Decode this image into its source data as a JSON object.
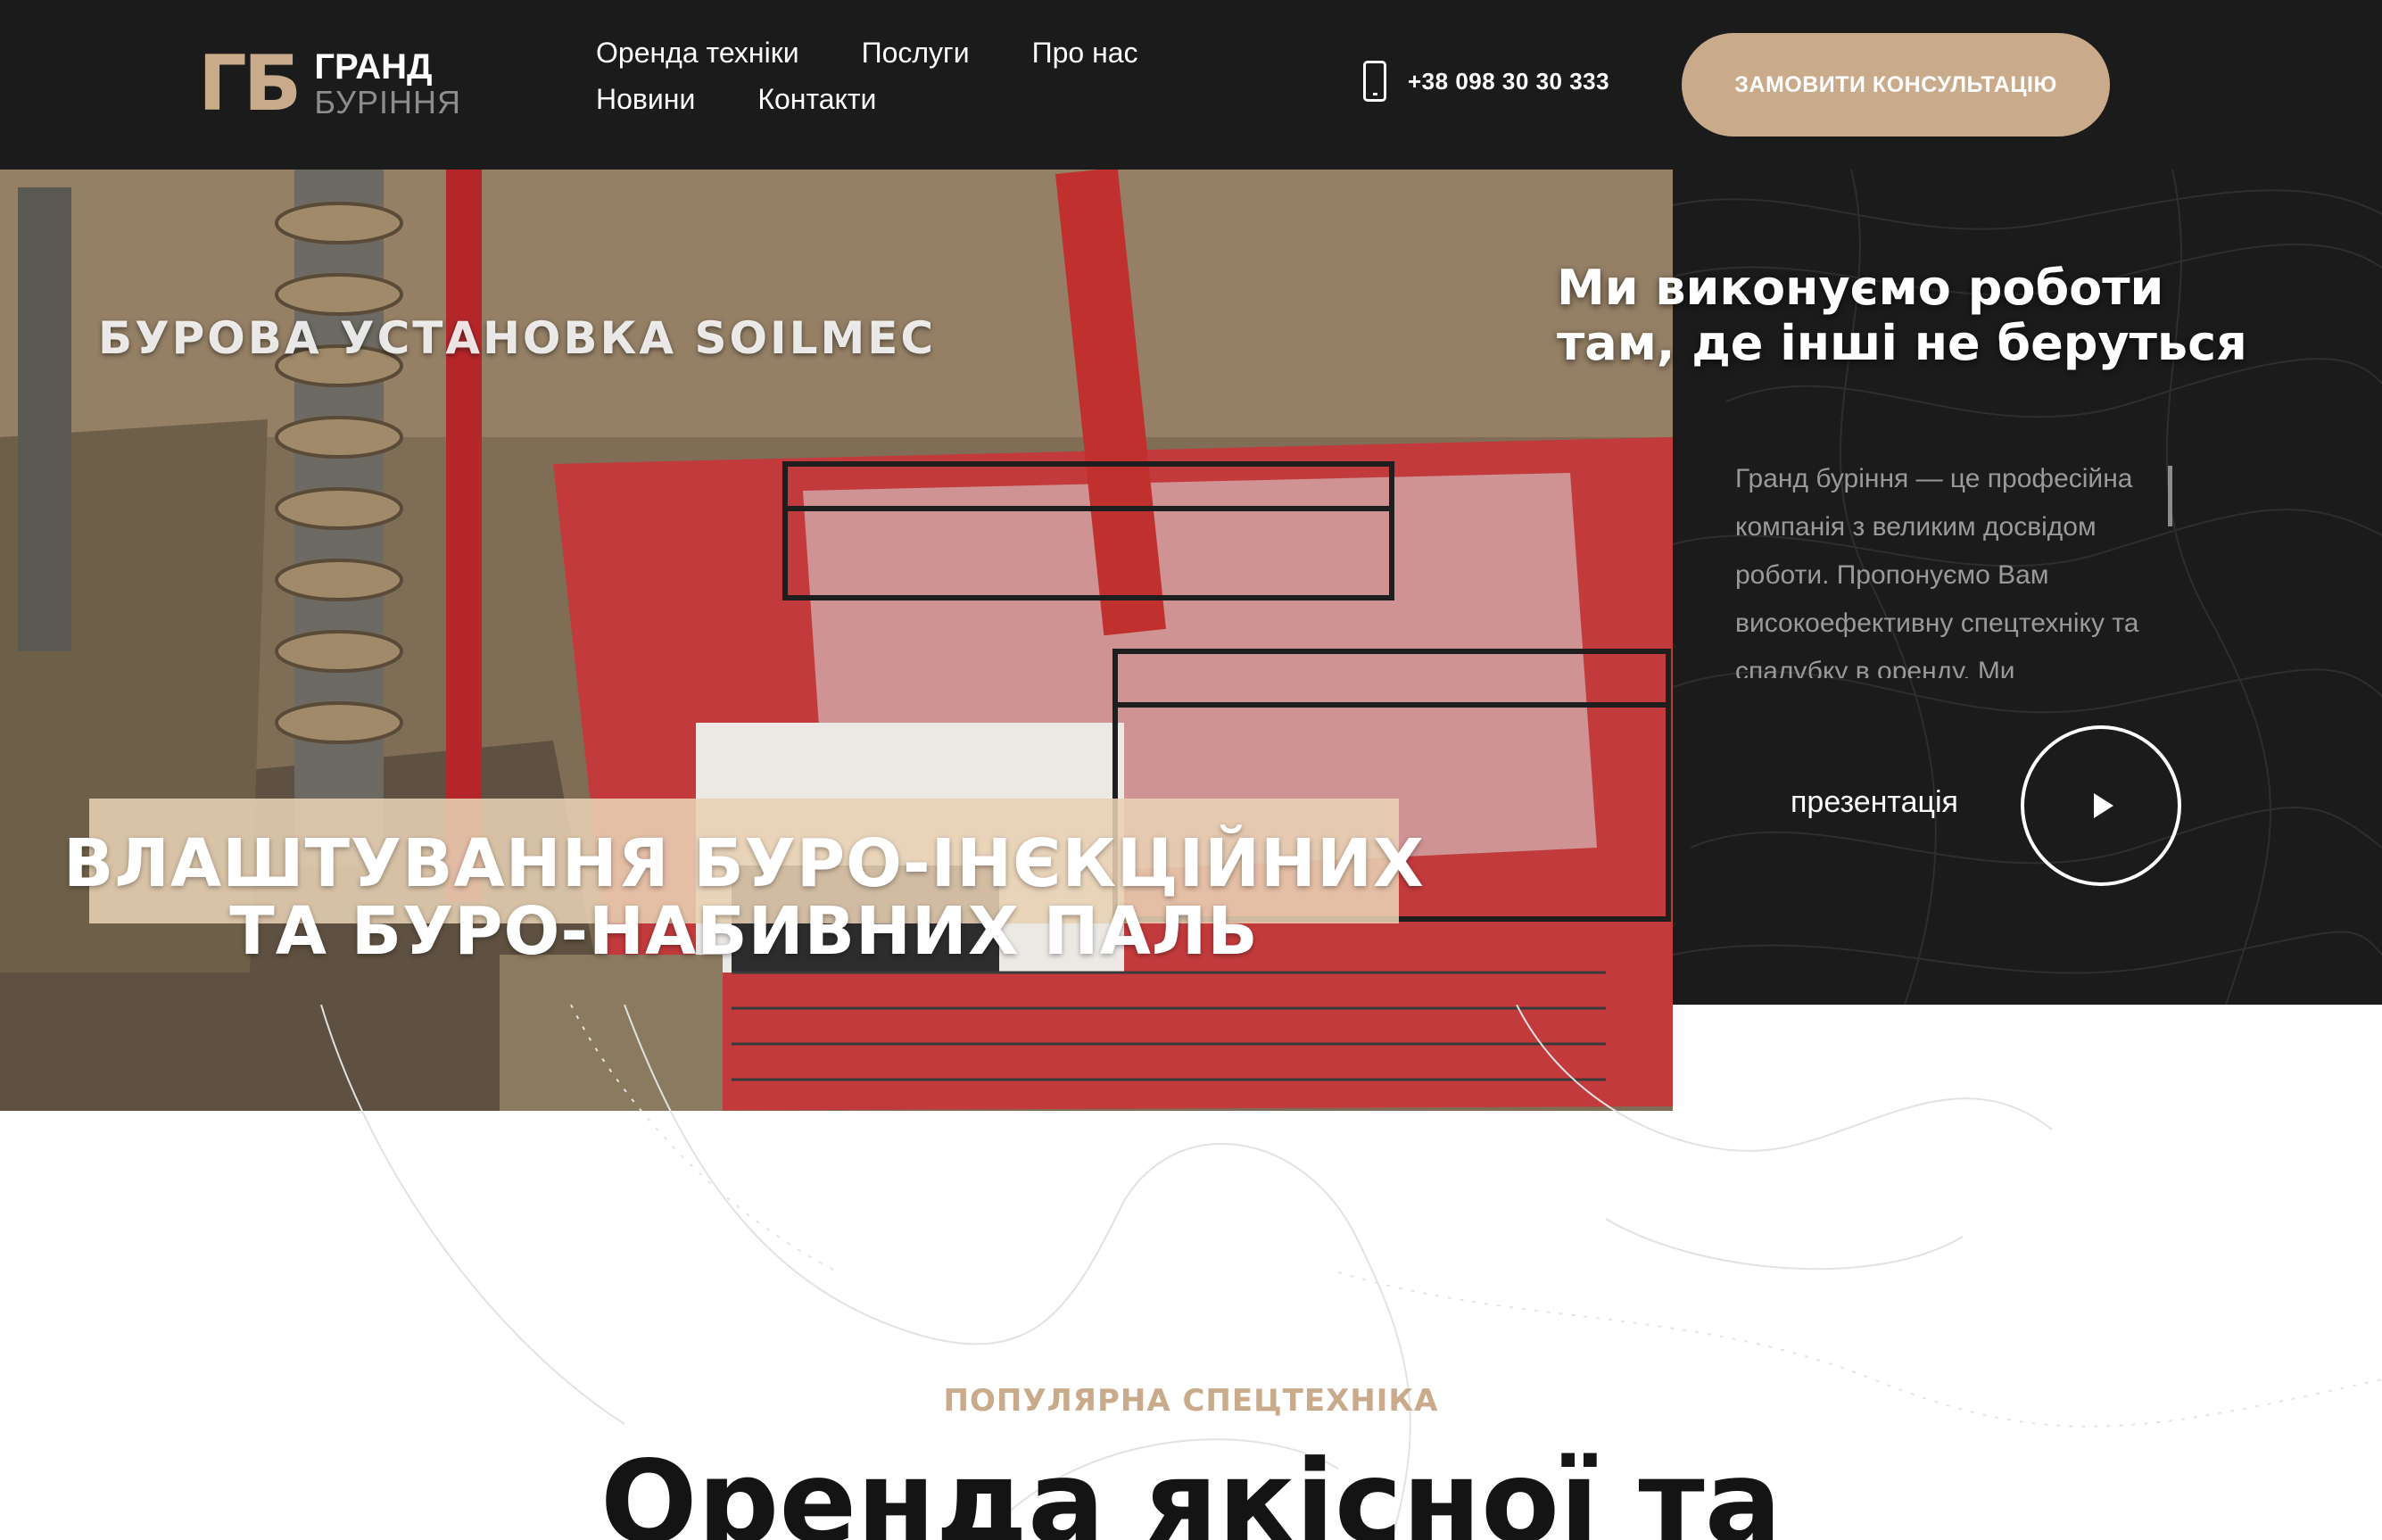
{
  "brand": {
    "mark": "ГБ",
    "line1": "ГРАНД",
    "line2": "БУРІННЯ"
  },
  "nav": {
    "items": [
      {
        "label": "Оренда техніки"
      },
      {
        "label": "Послуги"
      },
      {
        "label": "Про нас"
      },
      {
        "label": "Новини"
      },
      {
        "label": "Контакти"
      }
    ]
  },
  "contact": {
    "phone": "+38 098 30 30 333",
    "phone_icon": "mobile-phone-icon"
  },
  "cta": {
    "label": "ЗАМОВИТИ КОНСУЛЬТАЦІЮ"
  },
  "hero": {
    "title_line1": "Ми виконуємо роботи",
    "title_line2": "там, де інші не беруться",
    "description": "Гранд буріння — це професійна компанія з великим досвідом роботи. Пропонуємо Вам високоефективну спецтехніку та спалубку в оренду. Ми",
    "presentation_label": "презентація",
    "play_icon": "play-icon",
    "video_caption_top": "БУРОВА УСТАНОВКА SOILMEC",
    "video_caption_line1": "ВЛАШТУВАННЯ БУРО-ІНЄКЦІЙНИХ",
    "video_caption_line2": "ТА БУРО-НАБИВНИХ ПАЛЬ"
  },
  "section": {
    "eyebrow": "ПОПУЛЯРНА СПЕЦТЕХНІКА",
    "title": "Оренда якісної та"
  },
  "colors": {
    "accent": "#c9ab8b",
    "dark": "#1b1b1b",
    "white": "#ffffff",
    "muted_text": "#9a9a9a"
  }
}
